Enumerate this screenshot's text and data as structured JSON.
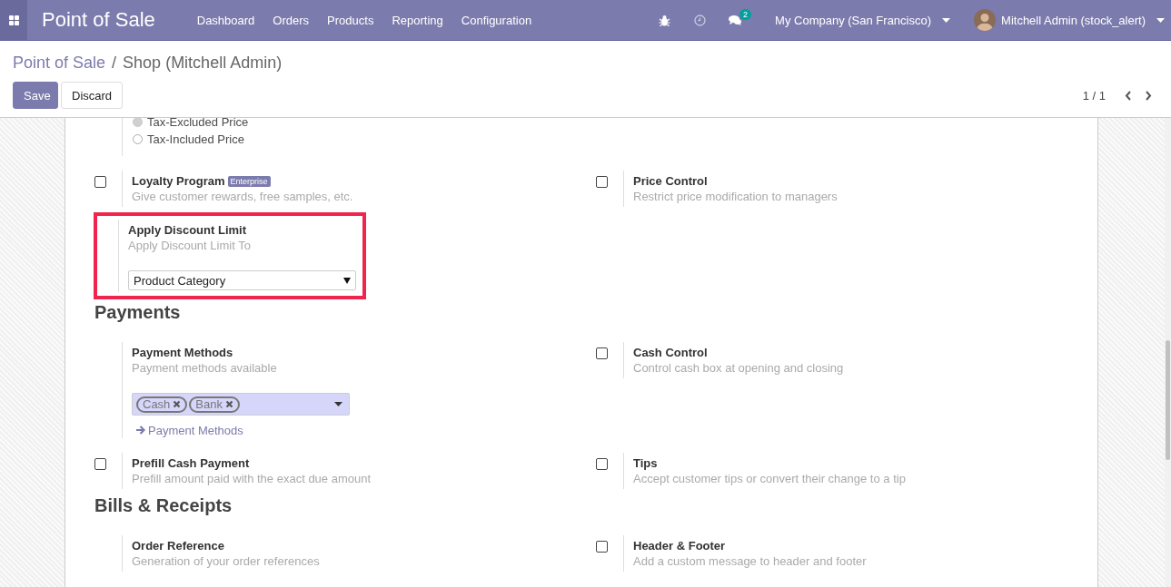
{
  "navbar": {
    "title": "Point of Sale",
    "menu": [
      {
        "label": "Dashboard"
      },
      {
        "label": "Orders"
      },
      {
        "label": "Products"
      },
      {
        "label": "Reporting"
      },
      {
        "label": "Configuration"
      }
    ],
    "messages_badge": "2",
    "company": "My Company (San Francisco)",
    "user": "Mitchell Admin (stock_alert)"
  },
  "breadcrumb": [
    {
      "label": "Point of Sale",
      "link": true
    },
    {
      "label": "Shop (Mitchell Admin)",
      "link": false
    }
  ],
  "breadcrumb_separator": "/",
  "buttons": [
    {
      "label": "Save",
      "kind": "primary"
    },
    {
      "label": "Discard",
      "kind": "secondary"
    }
  ],
  "pager": "1 / 1",
  "price_options": [
    {
      "label": "Tax-Excluded Price",
      "selected": true
    },
    {
      "label": "Tax-Included Price",
      "selected": false
    }
  ],
  "sections": [
    {
      "rows": [
        [
          {
            "kind": "checkbox",
            "checked": false,
            "title": "Loyalty Program",
            "badge": "Enterprise",
            "description": "Give customer rewards, free samples, etc."
          },
          {
            "kind": "checkbox",
            "checked": false,
            "title": "Price Control",
            "description": "Restrict price modification to managers"
          }
        ],
        [
          {
            "kind": "select",
            "highlighted": true,
            "title": "Apply Discount Limit",
            "description": "Apply Discount Limit To",
            "value": "Product Category"
          }
        ]
      ]
    },
    {
      "title": "Payments",
      "rows": [
        [
          {
            "kind": "tags",
            "title": "Payment Methods",
            "description": "Payment methods available",
            "tags": [
              {
                "label": "Cash"
              },
              {
                "label": "Bank"
              }
            ],
            "link": "Payment Methods"
          },
          {
            "kind": "checkbox",
            "checked": false,
            "title": "Cash Control",
            "description": "Control cash box at opening and closing"
          }
        ],
        [
          {
            "kind": "checkbox",
            "checked": false,
            "title": "Prefill Cash Payment",
            "description": "Prefill amount paid with the exact due amount"
          },
          {
            "kind": "checkbox",
            "checked": false,
            "title": "Tips",
            "description": "Accept customer tips or convert their change to a tip"
          }
        ]
      ]
    },
    {
      "title": "Bills & Receipts",
      "rows": [
        [
          {
            "kind": "plain",
            "title": "Order Reference",
            "description": "Generation of your order references"
          },
          {
            "kind": "checkbox",
            "checked": false,
            "title": "Header & Footer",
            "description": "Add a custom message to header and footer"
          }
        ]
      ]
    }
  ]
}
